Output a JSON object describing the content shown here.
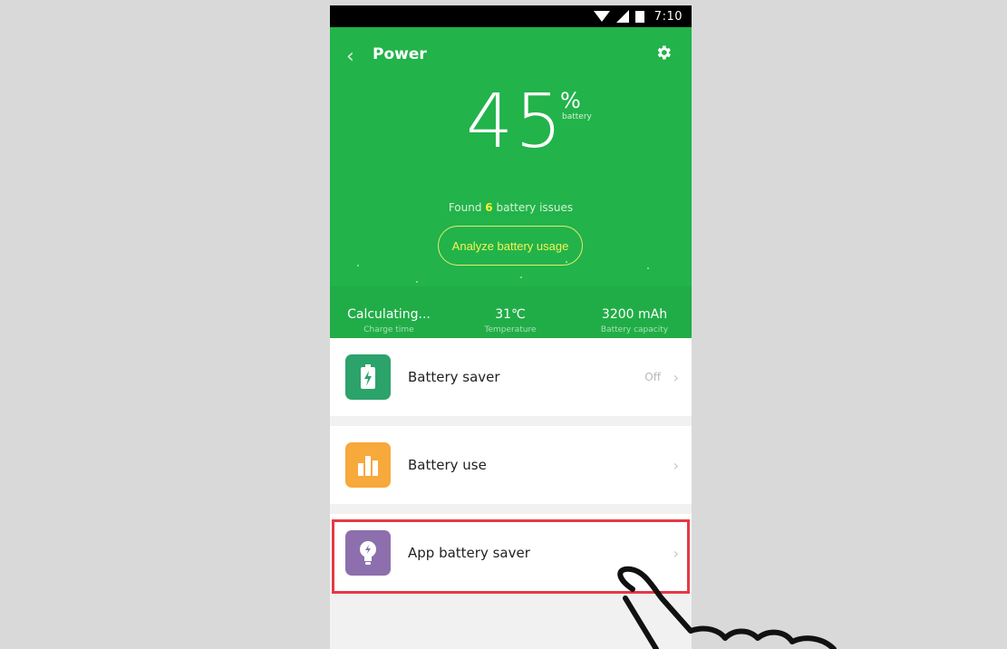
{
  "status_bar": {
    "time": "7:10"
  },
  "header": {
    "title": "Power",
    "back_icon": "chevron-left-icon",
    "settings_icon": "gear-icon"
  },
  "battery": {
    "percent": "45",
    "percent_sign": "%",
    "percent_label": "battery",
    "issues_prefix": "Found ",
    "issues_count": "6",
    "issues_suffix": " battery issues",
    "analyze_label": "Analyze battery usage"
  },
  "stats": [
    {
      "value": "Calculating...",
      "label": "Charge time"
    },
    {
      "value": "31℃",
      "label": "Temperature"
    },
    {
      "value": "3200 mAh",
      "label": "Battery capacity"
    }
  ],
  "list": [
    {
      "label": "Battery saver",
      "value": "Off",
      "icon": "battery-bolt-icon",
      "color": "#2ca36a"
    },
    {
      "label": "Battery use",
      "value": "",
      "icon": "bar-chart-icon",
      "color": "#f7a93b"
    },
    {
      "label": "App battery saver",
      "value": "",
      "icon": "lightbulb-icon",
      "color": "#8e6fad"
    }
  ],
  "colors": {
    "green": "#22b34a",
    "highlight": "#e63946"
  }
}
